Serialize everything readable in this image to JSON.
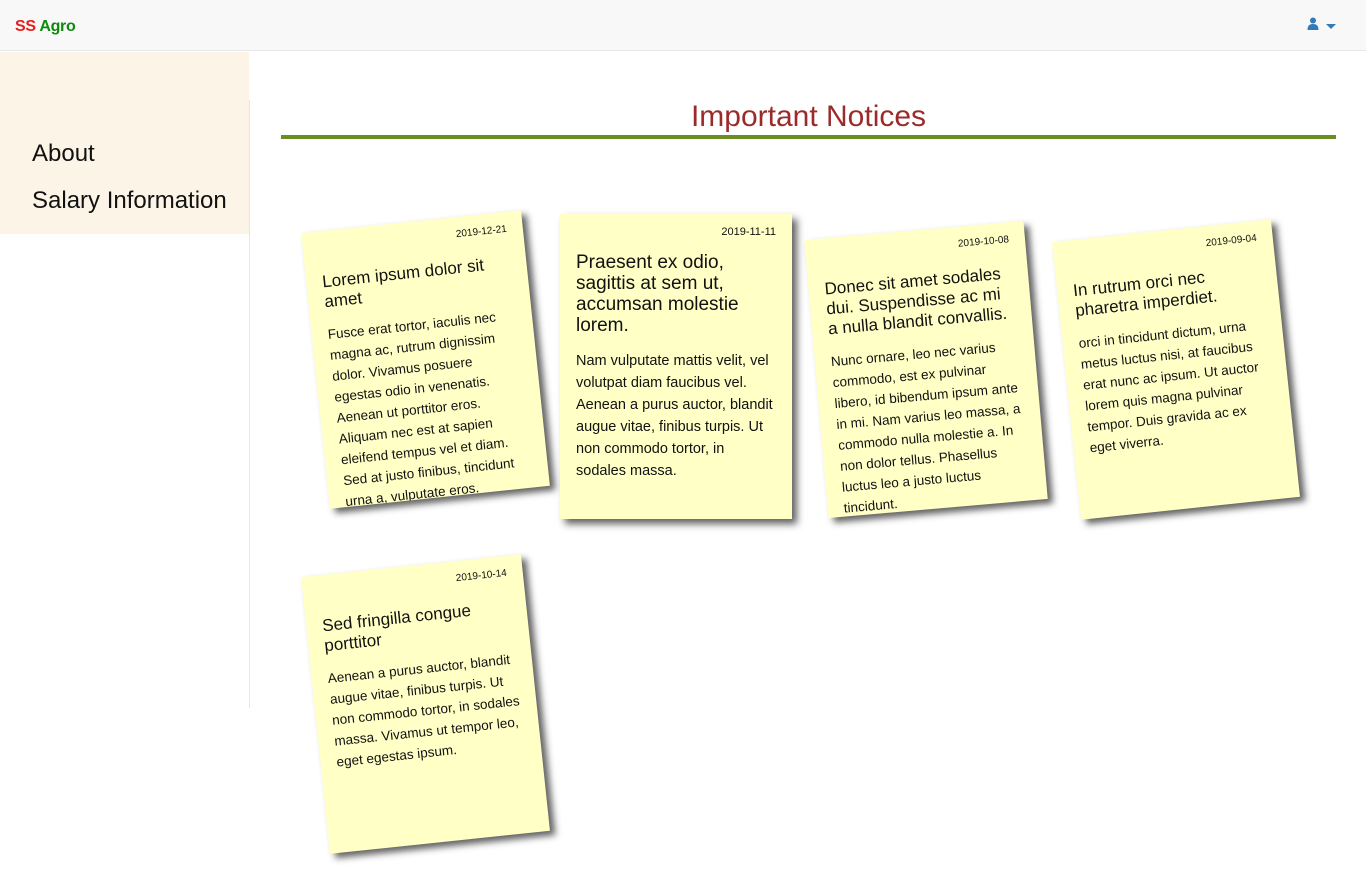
{
  "brand": {
    "part1": "SS",
    "part2": "Agro"
  },
  "user_menu": {
    "icon": "user-icon"
  },
  "sidebar": {
    "items": [
      {
        "label": "About"
      },
      {
        "label": "Salary Information"
      }
    ]
  },
  "page": {
    "title": "Important Notices"
  },
  "notices": [
    {
      "date": "2019-12-21",
      "title": "Lorem ipsum dolor sit amet",
      "body": "Fusce erat tortor, iaculis nec magna ac, rutrum dignissim dolor. Vivamus posuere egestas odio in venenatis. Aenean ut porttitor eros. Aliquam nec est at sapien eleifend tempus vel et diam. Sed at justo finibus, tincidunt urna a, vulputate eros."
    },
    {
      "date": "2019-11-11",
      "title": "Praesent ex odio, sagittis at sem ut, accumsan molestie lorem.",
      "body": "Nam vulputate mattis velit, vel volutpat diam faucibus vel. Aenean a purus auctor, blandit augue vitae, finibus turpis. Ut non commodo tortor, in sodales massa."
    },
    {
      "date": "2019-10-08",
      "title": "Donec sit amet sodales dui. Suspendisse ac mi a nulla blandit convallis.",
      "body": "Nunc ornare, leo nec varius commodo, est ex pulvinar libero, id bibendum ipsum ante in mi. Nam varius leo massa, a commodo nulla molestie a. In non dolor tellus. Phasellus luctus leo a justo luctus tincidunt."
    },
    {
      "date": "2019-09-04",
      "title": "In rutrum orci nec pharetra imperdiet.",
      "body": "orci in tincidunt dictum, urna metus luctus nisi, at faucibus erat nunc ac ipsum. Ut auctor lorem quis magna pulvinar tempor. Duis gravida ac ex eget viverra."
    },
    {
      "date": "2019-10-14",
      "title": "Sed fringilla congue porttitor",
      "body": "Aenean a purus auctor, blandit augue vitae, finibus turpis. Ut non commodo tortor, in sodales massa. Vivamus ut tempor leo, eget egestas ipsum."
    }
  ]
}
